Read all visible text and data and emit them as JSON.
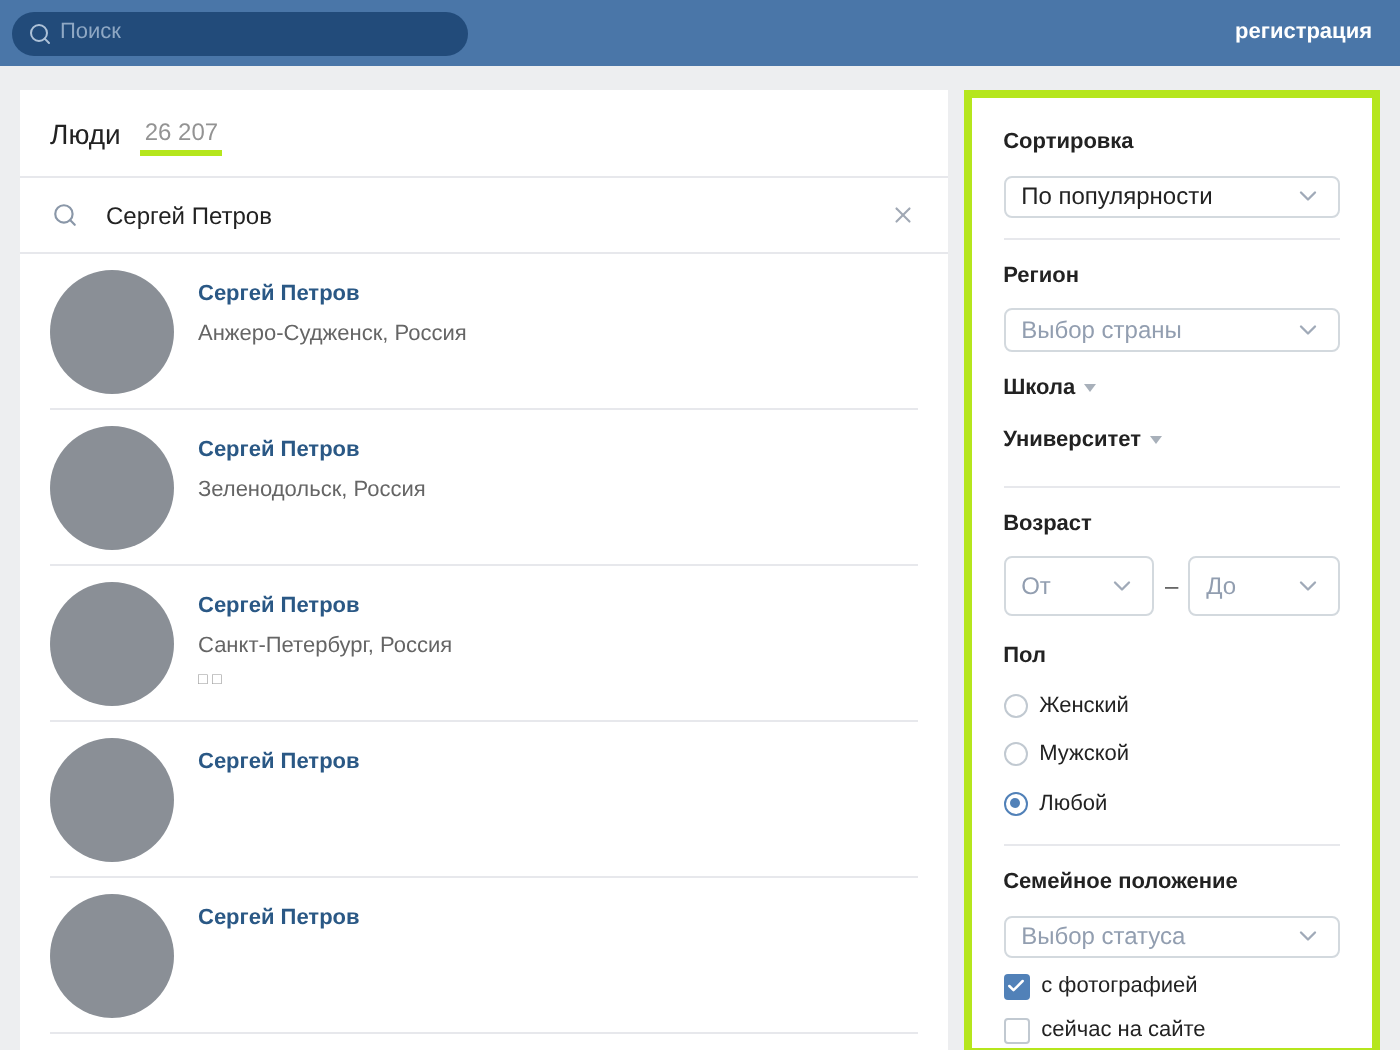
{
  "header": {
    "search_placeholder": "Поиск",
    "register_link": "регистрация"
  },
  "people": {
    "title": "Люди",
    "count": "26 207",
    "query": "Сергей Петров",
    "results": [
      {
        "name": "Сергей Петров",
        "city": "Анжеро-Судженск, Россия"
      },
      {
        "name": "Сергей Петров",
        "city": "Зеленодольск, Россия"
      },
      {
        "name": "Сергей Петров",
        "city": "Санкт-Петербург, Россия",
        "extra": "□ □"
      },
      {
        "name": "Сергей Петров"
      },
      {
        "name": "Сергей Петров"
      }
    ]
  },
  "filters": {
    "sort": {
      "label": "Сортировка",
      "value": "По популярности"
    },
    "region": {
      "label": "Регион",
      "placeholder": "Выбор страны"
    },
    "links": [
      "Школа",
      "Университет"
    ],
    "age": {
      "label": "Возраст",
      "from": "От",
      "dash": "–",
      "to": "До"
    },
    "gender": {
      "label": "Пол",
      "options": [
        {
          "label": "Женский",
          "selected": false
        },
        {
          "label": "Мужской",
          "selected": false
        },
        {
          "label": "Любой",
          "selected": true
        }
      ]
    },
    "family": {
      "label": "Семейное положение",
      "placeholder": "Выбор статуса"
    },
    "checks": [
      {
        "label": "с фотографией",
        "checked": true
      },
      {
        "label": "сейчас на сайте",
        "checked": false
      }
    ]
  }
}
